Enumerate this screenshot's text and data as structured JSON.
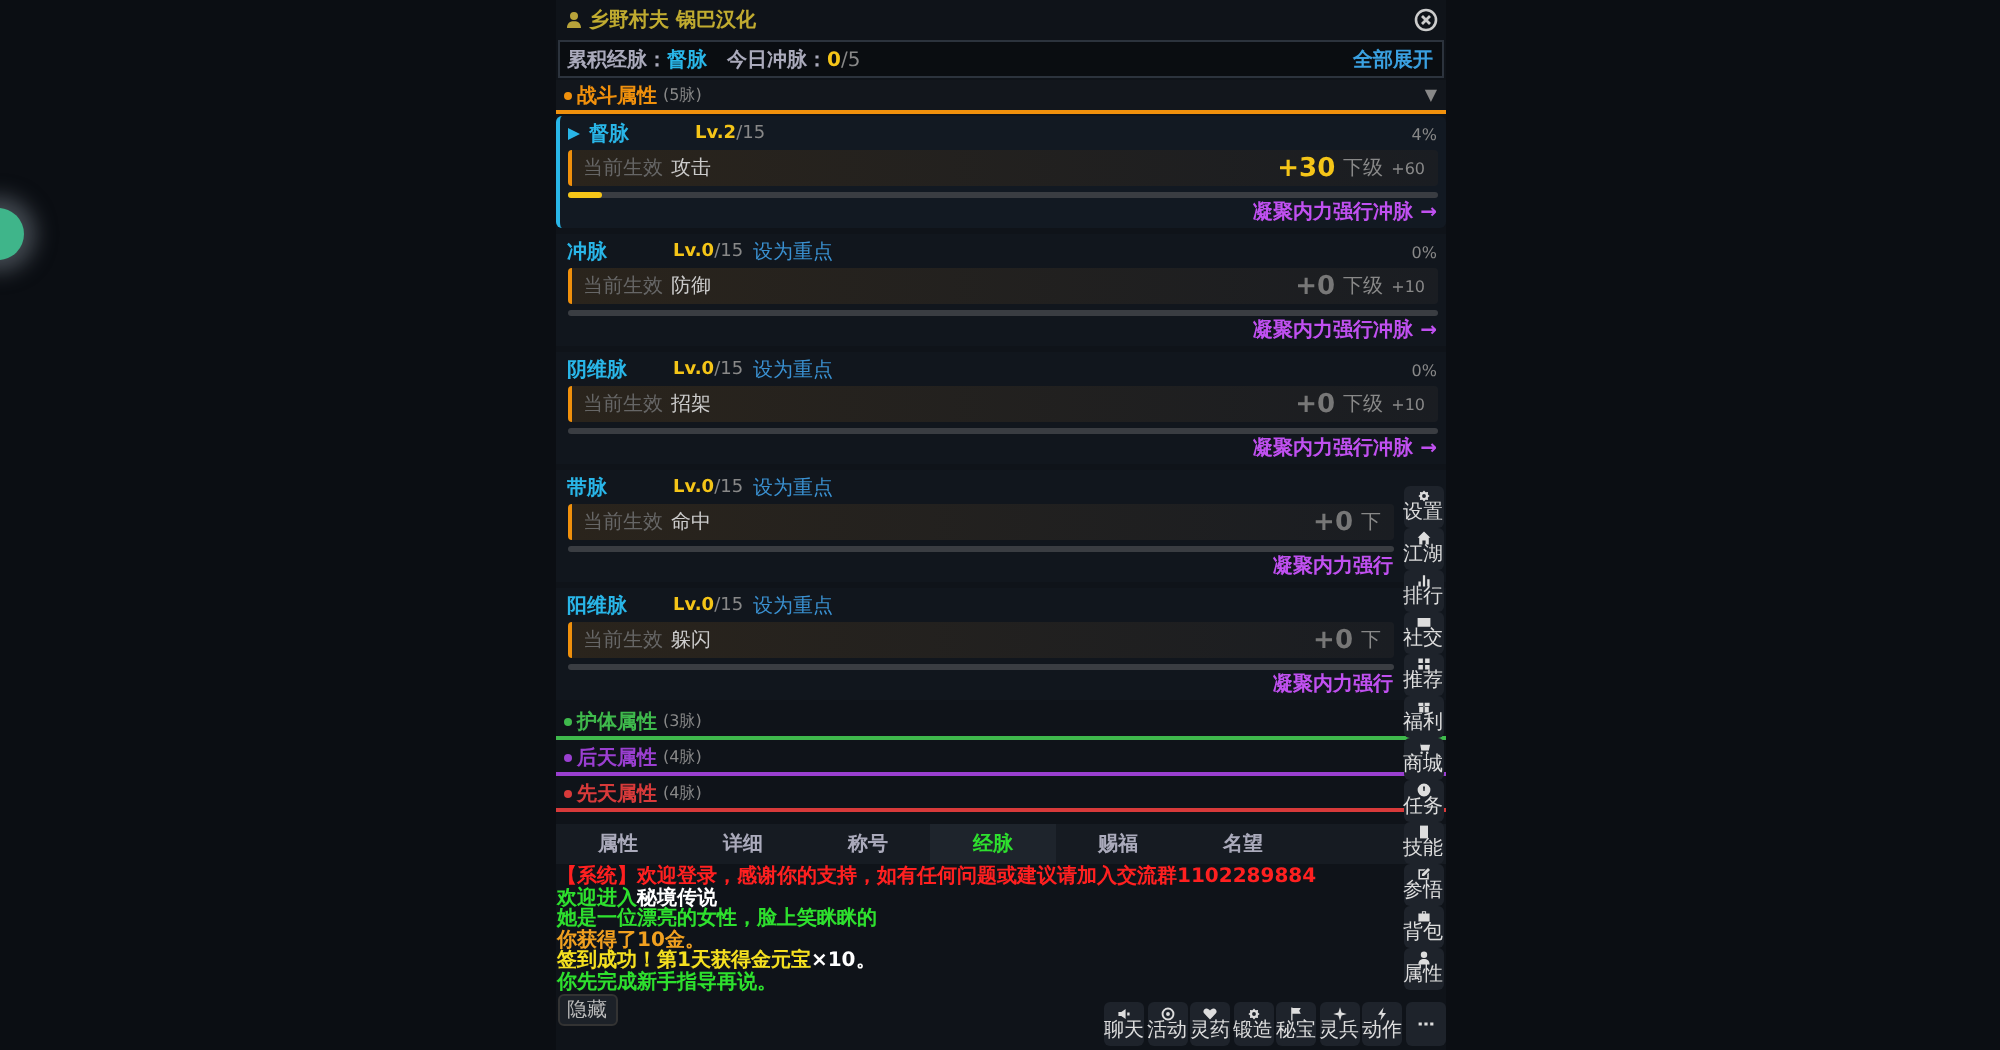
{
  "header": {
    "title": "乡野村夫 锅巴汉化"
  },
  "summary": {
    "accum_label": "累积经脉：",
    "accum_value": "督脉",
    "today_label": "今日冲脉：",
    "today_value": "0",
    "today_total": "/5",
    "expand_all": "全部展开"
  },
  "sections": [
    {
      "name": "战斗属性",
      "count": "(5脉)",
      "color": "#f0900c",
      "expanded": true,
      "caret": "▼",
      "meridians": [
        {
          "name": "督脉",
          "selected": true,
          "lv": "Lv.2",
          "max": "/15",
          "percent": "4%",
          "effect_label": "当前生效",
          "effect": "攻击",
          "bonus": "+30",
          "next_label": "下级",
          "next_value": "+60",
          "level": 0.04,
          "link": "凝聚内力强行冲脉 →"
        },
        {
          "name": "冲脉",
          "selected": false,
          "lv": "Lv.0",
          "max": "/15",
          "focus": "设为重点",
          "percent": "0%",
          "effect_label": "当前生效",
          "effect": "防御",
          "bonus": "+0",
          "next_label": "下级",
          "next_value": "+10",
          "link": "凝聚内力强行冲脉 →"
        },
        {
          "name": "阴维脉",
          "selected": false,
          "lv": "Lv.0",
          "max": "/15",
          "focus": "设为重点",
          "percent": "0%",
          "effect_label": "当前生效",
          "effect": "招架",
          "bonus": "+0",
          "next_label": "下级",
          "next_value": "+10",
          "link": "凝聚内力强行冲脉 →"
        },
        {
          "name": "带脉",
          "selected": false,
          "lv": "Lv.0",
          "max": "/15",
          "focus": "设为重点",
          "effect_label": "当前生效",
          "effect": "命中",
          "bonus": "+0",
          "next_label": "下",
          "link": "凝聚内力强行"
        },
        {
          "name": "阳维脉",
          "selected": false,
          "lv": "Lv.0",
          "max": "/15",
          "focus": "设为重点",
          "effect_label": "当前生效",
          "effect": "躲闪",
          "bonus": "+0",
          "next_label": "下",
          "link": "凝聚内力强行"
        }
      ]
    },
    {
      "name": "护体属性",
      "count": "(3脉)",
      "color": "#3fb94c",
      "expanded": false
    },
    {
      "name": "后天属性",
      "count": "(4脉)",
      "color": "#9a3fd0",
      "expanded": false
    },
    {
      "name": "先天属性",
      "count": "(4脉)",
      "color": "#d83a3a",
      "expanded": false
    }
  ],
  "tabs": [
    {
      "label": "属性",
      "selected": false
    },
    {
      "label": "详细",
      "selected": false
    },
    {
      "label": "称号",
      "selected": false
    },
    {
      "label": "经脉",
      "selected": true
    },
    {
      "label": "赐福",
      "selected": false
    },
    {
      "label": "名望",
      "selected": false
    }
  ],
  "chat": [
    {
      "parts": [
        {
          "text": "【系统】欢迎登录，感谢你的支持，如有任何问题或建议请加入交流群1102289884",
          "color": "#ff2020"
        }
      ]
    },
    {
      "parts": [
        {
          "text": "欢迎进入",
          "color": "#2ee02e"
        },
        {
          "text": "秘境传说",
          "color": "#ffffff"
        }
      ]
    },
    {
      "parts": [
        {
          "text": "她是一位漂亮的女性，脸上笑眯眯的",
          "color": "#2ee02e"
        }
      ]
    },
    {
      "parts": [
        {
          "text": "你获得了10金。",
          "color": "#f0a020"
        }
      ]
    },
    {
      "parts": [
        {
          "text": "签到成功！第1天获得金元宝",
          "color": "#f5e020"
        },
        {
          "text": "×10。",
          "color": "#ffffff"
        }
      ]
    },
    {
      "parts": [
        {
          "text": "你先完成新手指导再说。",
          "color": "#2ee02e"
        }
      ]
    }
  ],
  "chat_button": "隐藏",
  "side_menu": [
    {
      "label": "设置",
      "kind": "gear"
    },
    {
      "label": "江湖",
      "kind": "home"
    },
    {
      "label": "排行",
      "kind": "bars"
    },
    {
      "label": "社交",
      "kind": "mail"
    },
    {
      "label": "推荐",
      "kind": "grid"
    },
    {
      "label": "福利",
      "kind": "gift"
    },
    {
      "label": "商城",
      "kind": "cart"
    },
    {
      "label": "任务",
      "kind": "alert"
    },
    {
      "label": "技能",
      "kind": "book"
    },
    {
      "label": "参悟",
      "kind": "edit"
    },
    {
      "label": "背包",
      "kind": "bag"
    },
    {
      "label": "属性",
      "kind": "person"
    }
  ],
  "bottom_bar": [
    {
      "label": "聊天",
      "kind": "speaker"
    },
    {
      "label": "活动",
      "kind": "target"
    },
    {
      "label": "灵药",
      "kind": "heart"
    },
    {
      "label": "锻造",
      "kind": "gear"
    },
    {
      "label": "秘宝",
      "kind": "flag"
    },
    {
      "label": "灵兵",
      "kind": "star"
    },
    {
      "label": "动作",
      "kind": "bolt"
    },
    {
      "kind": "more"
    }
  ]
}
